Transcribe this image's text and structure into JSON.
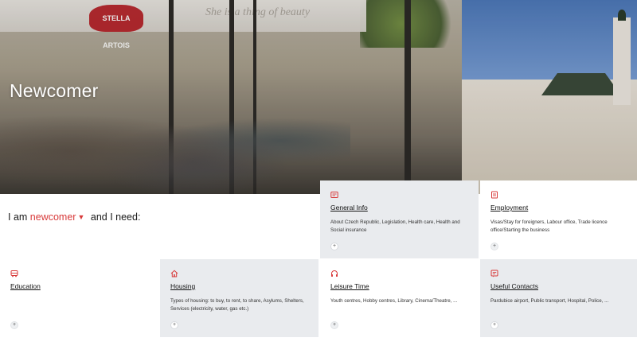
{
  "hero": {
    "title": "Newcomer",
    "awning_brand": "STELLA ARTOIS",
    "awning_slogan": "She is a thing of beauty"
  },
  "selector": {
    "prefix": "I am",
    "choice": "newcomer",
    "suffix": "and I need:"
  },
  "colors": {
    "accent": "#d83a3a",
    "card_grey": "#e9ebee"
  },
  "cards": [
    {
      "title": "General Info",
      "description": "About Czech Republic, Legislation, Health care, Health and Social insurance",
      "icon": "info-card-icon"
    },
    {
      "title": "Employment",
      "description": "Visas/Stay for foreigners, Labour office, Trade licence office/Starting the business",
      "icon": "briefcase-icon"
    },
    {
      "title": "Education",
      "description": "",
      "icon": "school-bus-icon"
    },
    {
      "title": "Housing",
      "description": "Types of housing: to buy, to rent, to share, Asylums, Shelters, Services (electricity, water, gas etc.)",
      "icon": "house-icon"
    },
    {
      "title": "Leisure Time",
      "description": "Youth centres, Hobby centres, Library, Cinema/Theatre, ...",
      "icon": "headphones-icon"
    },
    {
      "title": "Useful Contacts",
      "description": "Pardubice airport, Public transport, Hospital, Police, ...",
      "icon": "contacts-icon"
    }
  ],
  "more_symbol": "+"
}
